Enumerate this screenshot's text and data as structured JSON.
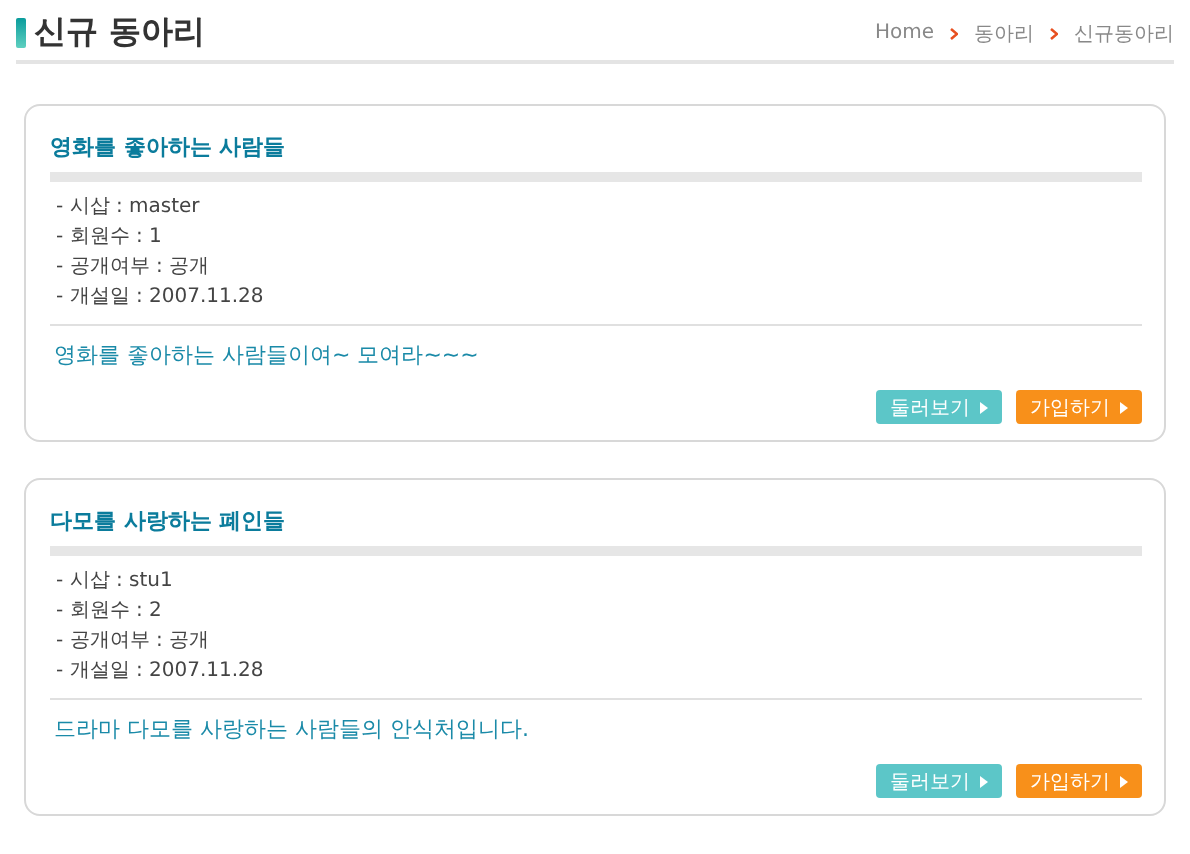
{
  "header": {
    "title": "신규 동아리",
    "breadcrumb": [
      "Home",
      "동아리",
      "신규동아리"
    ]
  },
  "clubs": [
    {
      "name": "영화를 좋아하는 사람들",
      "details": [
        "- 시삽 : master",
        "- 회원수 : 1",
        "- 공개여부 : 공개",
        "- 개설일 : 2007.11.28"
      ],
      "description": "영화를 좋아하는 사람들이여~ 모여라~~~",
      "buttons": [
        {
          "label": "둘러보기",
          "kind": "browse"
        },
        {
          "label": "가입하기",
          "kind": "join"
        }
      ]
    },
    {
      "name": "다모를 사랑하는 폐인들",
      "details": [
        "- 시삽 : stu1",
        "- 회원수 : 2",
        "- 공개여부 : 공개",
        "- 개설일 : 2007.11.28"
      ],
      "description": "드라마 다모를 사랑하는 사람들의 안식처입니다.",
      "buttons": [
        {
          "label": "둘러보기",
          "kind": "browse"
        },
        {
          "label": "가입하기",
          "kind": "join"
        }
      ]
    }
  ]
}
